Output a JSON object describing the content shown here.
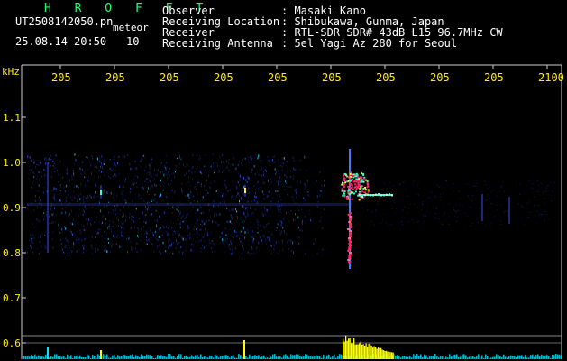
{
  "header": {
    "brand": "H R O F F T",
    "filename": "UT2508142050.pn",
    "tag": "meteor",
    "timestamp": "25.08.14 20:50",
    "count": "10",
    "info": [
      {
        "label": "Observer",
        "value": ": Masaki Kano"
      },
      {
        "label": "Receiving Location",
        "value": ": Shibukawa, Gunma, Japan"
      },
      {
        "label": "Receiver",
        "value": ": RTL-SDR SDR# 43dB L15 96.7MHz CW"
      },
      {
        "label": "Receiving Antenna",
        "value": ": 5el Yagi Az 280 for Seoul"
      }
    ]
  },
  "chart_data": {
    "type": "heatmap",
    "ylabel": "kHz",
    "y_ticks": [
      "1.1",
      "1.0",
      "0.9",
      "0.8",
      "0.7",
      "0.6"
    ],
    "x_ticks": [
      "205",
      "205",
      "205",
      "205",
      "205",
      "205",
      "205",
      "205",
      "205",
      "2100"
    ],
    "colors": {
      "background": "#000000",
      "tick_text": "#ffee00",
      "brand": "#19ff7a",
      "axis": "#cccccc",
      "signal_low": "#2233ff",
      "signal_mid": "#33ffcc",
      "signal_high": "#ff2266",
      "power_bar": "#ffff00",
      "power_noise": "#00e5ff"
    }
  }
}
